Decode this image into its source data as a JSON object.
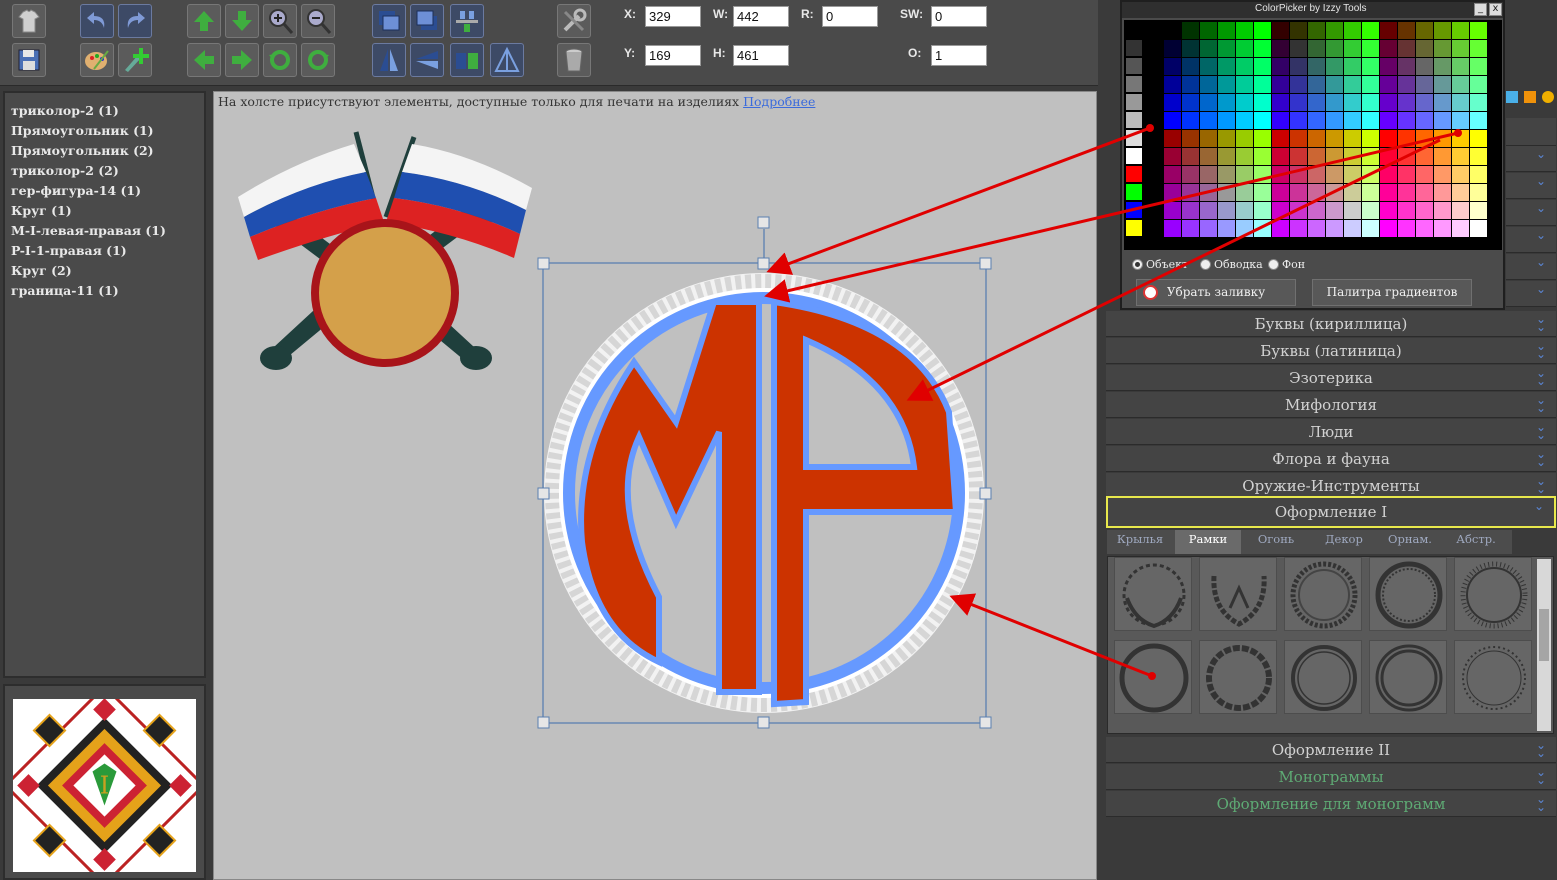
{
  "fields": {
    "x_label": "X:",
    "x_value": "329",
    "w_label": "W:",
    "w_value": "442",
    "r_label": "R:",
    "r_value": "0",
    "sw_label": "SW:",
    "sw_value": "0",
    "y_label": "Y:",
    "y_value": "169",
    "h_label": "H:",
    "h_value": "461",
    "o_label": "O:",
    "o_value": "1"
  },
  "layers": [
    "триколор-2 (1)",
    "Прямоугольник (1)",
    "Прямоугольник (2)",
    "триколор-2 (2)",
    "гер-фигура-14 (1)",
    "Круг (1)",
    "M-I-левая-правая (1)",
    "P-I-1-правая (1)",
    "Круг (2)",
    "граница-11 (1)"
  ],
  "canvas": {
    "notice": "На холсте присутствуют элементы, доступные только для печати на изделиях",
    "notice_link": "Подробнее"
  },
  "colorpicker": {
    "title": "ColorPicker by Izzy Tools",
    "minimize": "_",
    "close": "x",
    "radio_object": "Объект",
    "radio_stroke": "Обводка",
    "radio_background": "Фон",
    "remove_fill": "Убрать заливку",
    "gradient_palette": "Палитра градиентов"
  },
  "categories": [
    {
      "label": "Буквы (кириллица)"
    },
    {
      "label": "Буквы (латиница)"
    },
    {
      "label": "Эзотерика"
    },
    {
      "label": "Мифология"
    },
    {
      "label": "Люди"
    },
    {
      "label": "Флора и фауна"
    },
    {
      "label": "Оружие-Инструменты"
    },
    {
      "label": "Оформление I"
    },
    {
      "label": "Оформление II"
    },
    {
      "label": "Монограммы"
    },
    {
      "label": "Оформление для монограмм"
    }
  ],
  "subtabs": [
    "Крылья",
    "Рамки",
    "Огонь",
    "Декор",
    "Орнам.",
    "Абстр."
  ],
  "icons": {
    "chevron": "⌄"
  },
  "colors": {
    "monogram_red": "#cc3300",
    "monogram_blue": "#6699ff",
    "selected_border": "#e8e84c",
    "link": "#3b6bdc",
    "arrow": "#e00000"
  }
}
